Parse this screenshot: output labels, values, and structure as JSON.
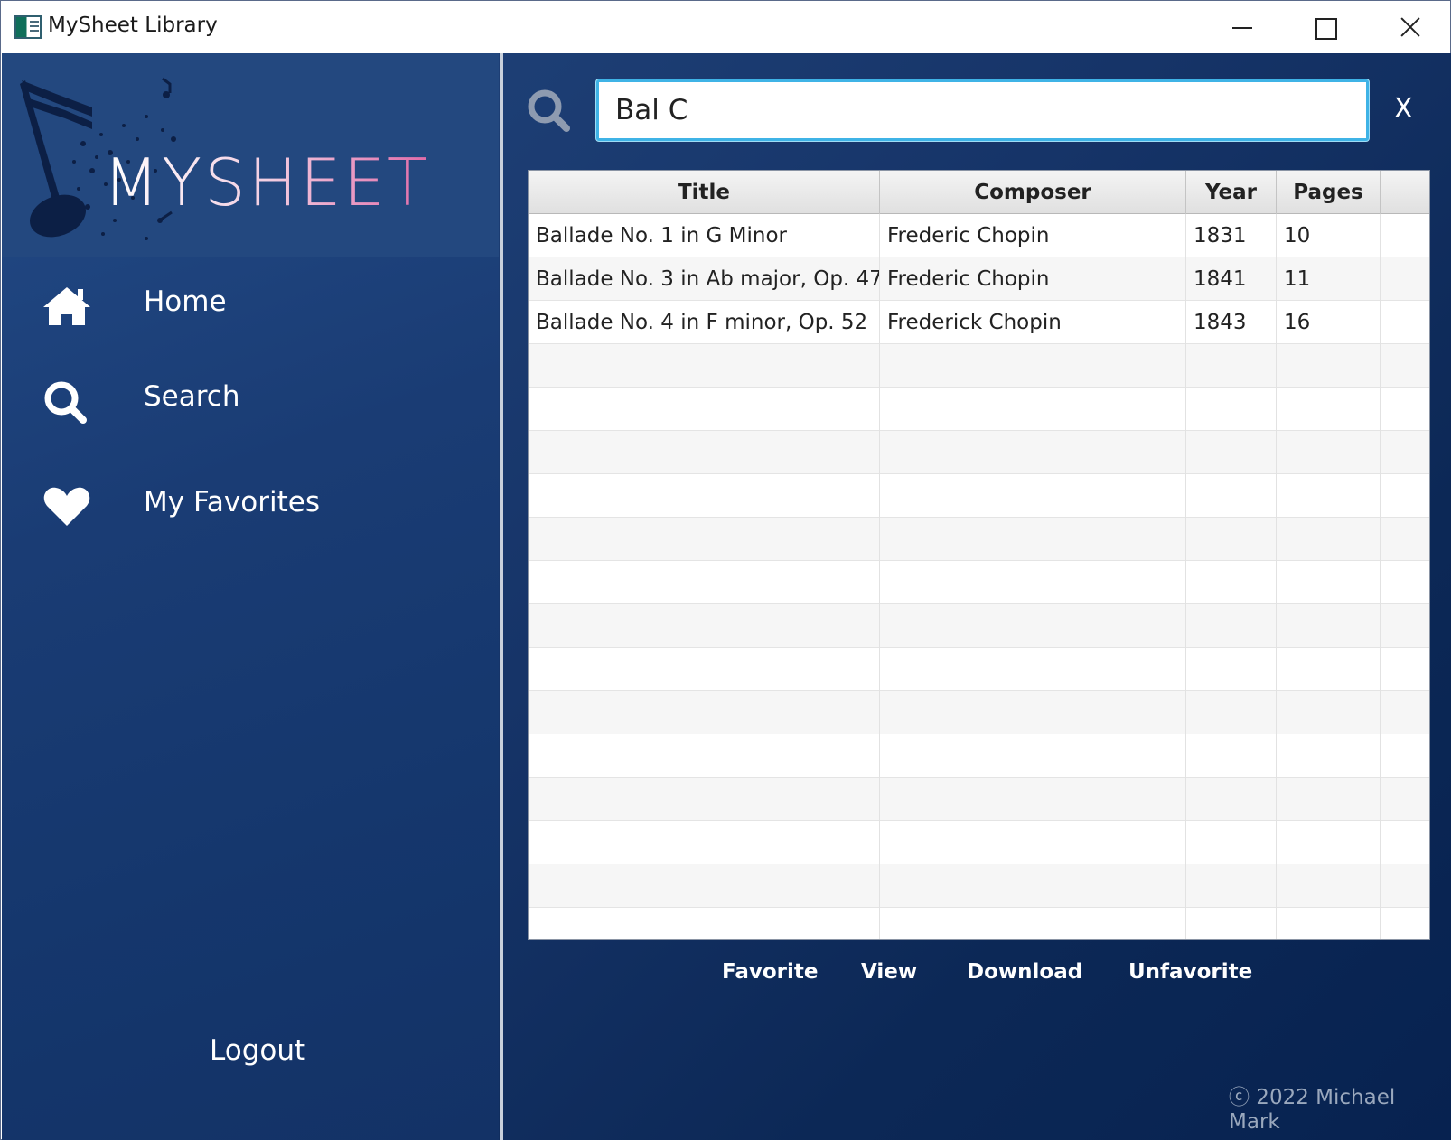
{
  "window": {
    "title": "MySheet Library"
  },
  "sidebar": {
    "logo_text": "MYSHEET",
    "items": [
      {
        "label": "Home",
        "icon": "home-icon"
      },
      {
        "label": "Search",
        "icon": "search-icon"
      },
      {
        "label": "My Favorites",
        "icon": "heart-icon"
      }
    ],
    "logout_label": "Logout"
  },
  "search": {
    "value": "Bal C",
    "clear_label": "X"
  },
  "table": {
    "columns": [
      "Title",
      "Composer",
      "Year",
      "Pages"
    ],
    "rows": [
      [
        "Ballade No. 1 in G Minor",
        "Frederic Chopin",
        "1831",
        "10"
      ],
      [
        "Ballade No. 3 in Ab major, Op. 47",
        "Frederic Chopin",
        "1841",
        "11"
      ],
      [
        "Ballade No. 4 in F minor, Op. 52",
        "Frederick Chopin",
        "1843",
        "16"
      ]
    ]
  },
  "actions": {
    "favorite": "Favorite",
    "view": "View",
    "download": "Download",
    "unfavorite": "Unfavorite"
  },
  "footer": {
    "copyright": "ⓒ 2022 Michael Mark"
  },
  "colors": {
    "accent": "#3fb3e6",
    "sidebar_bg": "#1a3c74",
    "logo_pink": "#e06aa8"
  }
}
